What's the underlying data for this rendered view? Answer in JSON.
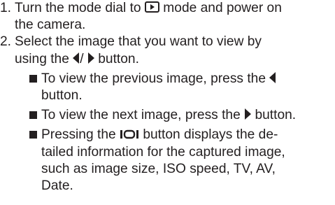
{
  "step1": {
    "number": "1.",
    "text_before_icon": "Turn the mode dial to",
    "text_after_icon": "mode and power on",
    "text_line2": "the camera."
  },
  "step2": {
    "number": "2.",
    "line1": "Select the image that you want to view by",
    "line2_before": "using the",
    "line2_after": "button.",
    "bullets": [
      {
        "text_before": "To view the previous image, press the",
        "text_line2": "button."
      },
      {
        "text_before": "To view the next image, press the",
        "text_after": "button."
      },
      {
        "text_before": "Pressing the",
        "text_after": "button displays the de-",
        "text_rest_lines": [
          "tailed information for the captured image,",
          "such as image size, ISO speed, TV, AV,",
          "Date."
        ]
      }
    ]
  },
  "icons": [
    "playback-mode-icon",
    "left-arrow-icon",
    "right-arrow-icon",
    "display-button-icon"
  ]
}
